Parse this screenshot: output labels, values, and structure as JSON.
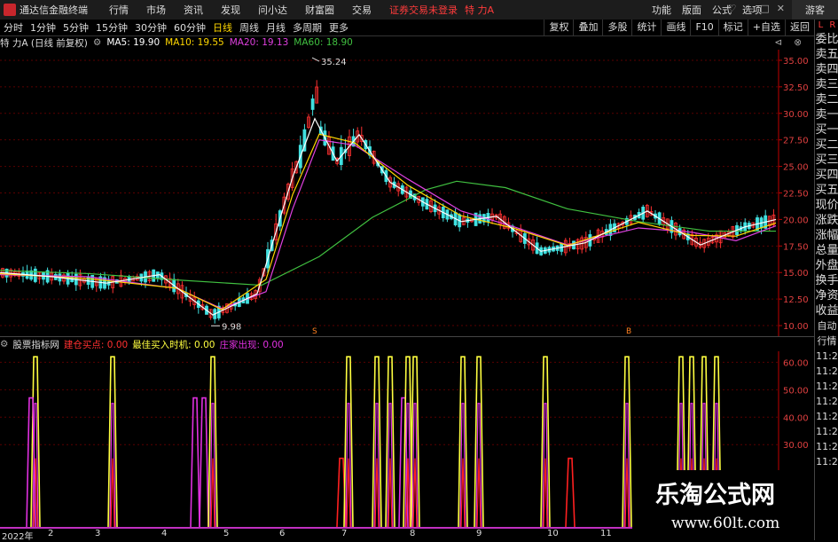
{
  "app": {
    "name": "通达信金融终端",
    "notice": "证券交易未登录",
    "stock": "特 力A",
    "guest": "游客"
  },
  "menu": [
    "行情",
    "市场",
    "资讯",
    "发现",
    "问小达",
    "财富圈",
    "交易"
  ],
  "rmenu": [
    "功能",
    "版面",
    "公式",
    "选项"
  ],
  "toolbar": {
    "timeframes": [
      "分时",
      "1分钟",
      "5分钟",
      "15分钟",
      "30分钟",
      "60分钟",
      "日线",
      "周线",
      "月线",
      "多周期",
      "更多"
    ],
    "active": "日线",
    "right": [
      "复权",
      "叠加",
      "多股",
      "统计",
      "画线",
      "F10",
      "标记",
      "+自选",
      "返回"
    ]
  },
  "info": {
    "name": "特 力A (日线 前复权)",
    "ma5": "MA5: 19.90",
    "ma10": "MA10: 19.55",
    "ma20": "MA20: 19.13",
    "ma60": "MA60: 18.90"
  },
  "colors": {
    "up": "#ff3030",
    "down": "#40e0e0",
    "ma5": "#ffffff",
    "ma10": "#ffd700",
    "ma20": "#e040e0",
    "ma60": "#40c040",
    "grid": "#5a0000",
    "axis": "#c00000",
    "ind_yellow": "#ffff40",
    "ind_red": "#ff2020",
    "ind_magenta": "#e030e0"
  },
  "price_axis": [
    "35.00",
    "32.50",
    "30.00",
    "27.50",
    "25.00",
    "22.50",
    "20.00",
    "17.50",
    "15.00",
    "12.50",
    "10.00"
  ],
  "price_labels": {
    "high": "35.24",
    "low": "9.98"
  },
  "markers": [
    "S",
    "B"
  ],
  "indicator": {
    "name": "股票指标网",
    "a": "建仓买点: 0.00",
    "b": "最佳买入时机: 0.00",
    "c": "庄家出现: 0.00",
    "axis": [
      "60.00",
      "50.00",
      "40.00",
      "30.00"
    ]
  },
  "time_axis": [
    "2022年",
    "2",
    "3",
    "4",
    "5",
    "6",
    "7",
    "8",
    "9",
    "10",
    "11"
  ],
  "rpanel": {
    "top": [
      "L",
      "R"
    ],
    "items": [
      "委比",
      "卖五",
      "卖四",
      "卖三",
      "卖二",
      "卖一",
      "买一",
      "买二",
      "买三",
      "买四",
      "买五",
      "现价",
      "涨跌",
      "涨幅",
      "总量",
      "外盘",
      "换手",
      "净资",
      "收益",
      "自动",
      "行情",
      "11:2",
      "11:2",
      "11:2",
      "11:2",
      "11:2",
      "11:2",
      "11:2",
      "11:2"
    ]
  },
  "watermark": {
    "line1": "乐淘公式网",
    "line2": "www.60lt.com"
  },
  "chart_data": {
    "type": "candlestick",
    "ylim": [
      9,
      36
    ],
    "high": 35.24,
    "low": 9.98,
    "ma_points": {
      "ma60": [
        [
          0,
          15.2
        ],
        [
          100,
          14.9
        ],
        [
          200,
          14.3
        ],
        [
          295,
          13.8
        ],
        [
          360,
          16.5
        ],
        [
          420,
          20.2
        ],
        [
          480,
          22.8
        ],
        [
          515,
          23.6
        ],
        [
          570,
          23.0
        ],
        [
          640,
          21.0
        ],
        [
          720,
          19.8
        ],
        [
          800,
          18.9
        ],
        [
          875,
          18.9
        ]
      ],
      "ma20": [
        [
          0,
          14.8
        ],
        [
          100,
          14.6
        ],
        [
          200,
          13.5
        ],
        [
          250,
          11.6
        ],
        [
          300,
          13.2
        ],
        [
          330,
          21.0
        ],
        [
          360,
          27.5
        ],
        [
          400,
          27.0
        ],
        [
          460,
          23.8
        ],
        [
          520,
          20.8
        ],
        [
          580,
          19.3
        ],
        [
          640,
          17.6
        ],
        [
          720,
          19.2
        ],
        [
          780,
          18.8
        ],
        [
          830,
          18.0
        ],
        [
          875,
          19.4
        ]
      ],
      "ma5": [
        [
          0,
          15.0
        ],
        [
          60,
          14.6
        ],
        [
          120,
          14.0
        ],
        [
          180,
          14.8
        ],
        [
          240,
          11.0
        ],
        [
          290,
          13.0
        ],
        [
          330,
          24.0
        ],
        [
          355,
          29.5
        ],
        [
          380,
          25.5
        ],
        [
          405,
          28.0
        ],
        [
          440,
          23.5
        ],
        [
          480,
          21.5
        ],
        [
          520,
          19.8
        ],
        [
          560,
          20.3
        ],
        [
          610,
          17.0
        ],
        [
          660,
          17.8
        ],
        [
          730,
          20.8
        ],
        [
          790,
          17.6
        ],
        [
          840,
          19.3
        ],
        [
          875,
          20.0
        ]
      ]
    }
  },
  "indicator_spikes": [
    [
      40,
      "y"
    ],
    [
      35,
      "m"
    ],
    [
      127,
      "y"
    ],
    [
      220,
      "m"
    ],
    [
      230,
      "m"
    ],
    [
      240,
      "y"
    ],
    [
      385,
      "r"
    ],
    [
      393,
      "y"
    ],
    [
      425,
      "y"
    ],
    [
      440,
      "y"
    ],
    [
      455,
      "m"
    ],
    [
      460,
      "y"
    ],
    [
      468,
      "y"
    ],
    [
      522,
      "y"
    ],
    [
      540,
      "y"
    ],
    [
      615,
      "y"
    ],
    [
      643,
      "r"
    ],
    [
      707,
      "y"
    ],
    [
      768,
      "y"
    ],
    [
      780,
      "y"
    ],
    [
      794,
      "y"
    ],
    [
      808,
      "y"
    ]
  ]
}
